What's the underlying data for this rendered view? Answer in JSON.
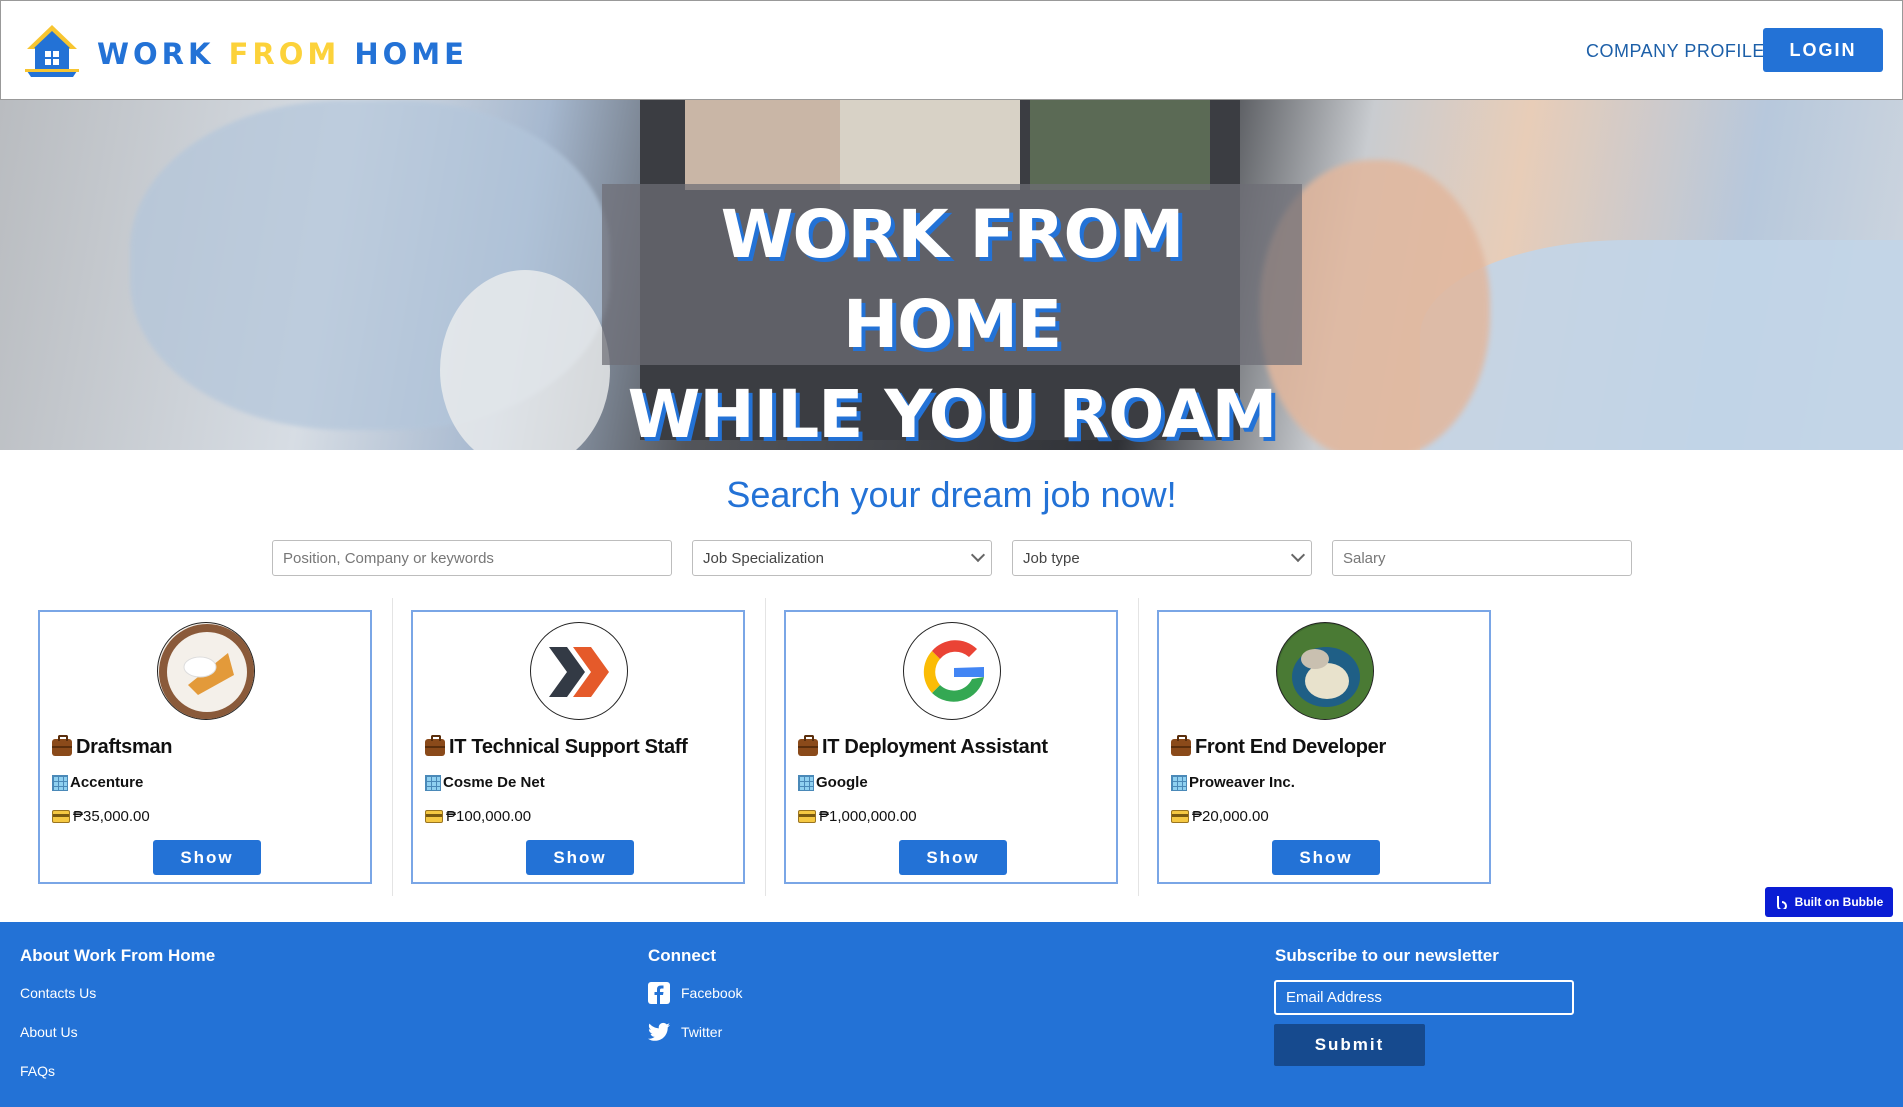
{
  "header": {
    "brand": {
      "word1": "WORK",
      "word2": "FROM",
      "word3": "HOME"
    },
    "nav_company_profiles": "COMPANY PROFILES",
    "login_label": "LOGIN"
  },
  "hero": {
    "title_line1": "WORK FROM HOME",
    "title_line2": "WHILE YOU ROAM"
  },
  "search": {
    "heading": "Search your dream job now!",
    "keyword_placeholder": "Position, Company or keywords",
    "specialization_value": "Job Specialization",
    "job_type_value": "Job type",
    "salary_placeholder": "Salary"
  },
  "jobs": [
    {
      "title": "Draftsman",
      "company": "Accenture",
      "salary": "₱35,000.00",
      "button": "Show",
      "avatar": "food-plate"
    },
    {
      "title": "IT Technical Support Staff",
      "company": "Cosme De Net",
      "salary": "₱100,000.00",
      "button": "Show",
      "avatar": "arrow-logo"
    },
    {
      "title": "IT Deployment Assistant",
      "company": "Google",
      "salary": "₱1,000,000.00",
      "button": "Show",
      "avatar": "google-logo"
    },
    {
      "title": "Front End Developer",
      "company": "Proweaver Inc.",
      "salary": "₱20,000.00",
      "button": "Show",
      "avatar": "snorlax"
    }
  ],
  "bubble_badge": "Built on Bubble",
  "footer": {
    "about_heading": "About Work From Home",
    "about_links": [
      "Contacts Us",
      "About Us",
      "FAQs"
    ],
    "connect_heading": "Connect",
    "facebook": "Facebook",
    "twitter": "Twitter",
    "newsletter_heading": "Subscribe to our newsletter",
    "email_placeholder": "Email Address",
    "submit_label": "Submit"
  },
  "colors": {
    "primary": "#2372d6",
    "accent_yellow": "#fcd23a",
    "footer_bg": "#2372d6",
    "submit_bg": "#164a8e",
    "bubble": "#0a1dd4"
  }
}
